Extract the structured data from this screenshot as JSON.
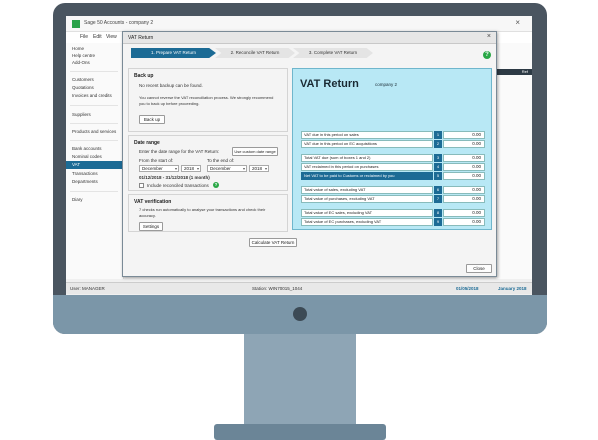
{
  "app": {
    "title": "Sage 50 Accounts - company 2",
    "close_glyph": "×",
    "menu": [
      "File",
      "Edit",
      "View"
    ]
  },
  "nav": {
    "group1": [
      "Home",
      "Help centre",
      "Add-Ons"
    ],
    "group2": [
      "Customers",
      "Quotations",
      "Invoices and credits"
    ],
    "group3": [
      "Suppliers"
    ],
    "group4": [
      "Products and services"
    ],
    "group5": [
      "Bank accounts",
      "Nominal codes",
      "VAT",
      "Transactions",
      "Departments"
    ],
    "group6": [
      "Diary"
    ],
    "active": "VAT"
  },
  "right_strip": {
    "label": "Ref"
  },
  "status": {
    "user_label": "User: MANAGER",
    "station_label": "Station: WIN70015_1044",
    "date": "01/05/2018",
    "period": "January 2018"
  },
  "dialog": {
    "title": "VAT Return",
    "close_glyph": "×",
    "steps": [
      "1. Prepare VAT Return",
      "2. Reconcile VAT Return",
      "3. Complete VAT Return"
    ],
    "help_glyph": "?"
  },
  "backup": {
    "title": "Back up",
    "line1": "No recent backup can be found.",
    "line2": "You cannot reverse the VAT reconciliation process. We strongly recommend",
    "line3": "you to back up before proceeding.",
    "button": "Back up"
  },
  "date_range": {
    "title": "Date range",
    "prompt": "Enter the date range for the VAT Return:",
    "custom_button": "Use custom date range",
    "from_label": "From the start of:",
    "to_label": "To the end of:",
    "from_month": "December",
    "from_year": "2018",
    "to_month": "December",
    "to_year": "2018",
    "summary": "01/12/2018 - 31/12/2018 (1 month)",
    "include_label": "Include reconciled transactions",
    "info_glyph": "?"
  },
  "verification": {
    "title": "VAT verification",
    "line1": "7 checks run automatically to analyse your transactions and check their",
    "line2": "accuracy.",
    "button": "Settings"
  },
  "calculate_button": "Calculate VAT Return",
  "close_button": "Close",
  "vat_return": {
    "title": "VAT Return",
    "company": "company 2",
    "rows": [
      {
        "label": "VAT due in this period on sales",
        "box": "1",
        "value": "0.00"
      },
      {
        "label": "VAT due in this period on EC acquisitions",
        "box": "2",
        "value": "0.00"
      },
      {
        "label": "Total VAT due (sum of boxes 1 and 2)",
        "box": "3",
        "value": "0.00"
      },
      {
        "label": "VAT reclaimed in this period on purchases",
        "box": "4",
        "value": "0.00"
      },
      {
        "label": "Net VAT to be paid to Customs or reclaimed by you",
        "box": "5",
        "value": "0.00"
      },
      {
        "label": "Total value of sales, excluding VAT",
        "box": "6",
        "value": "0.00"
      },
      {
        "label": "Total value of purchases, excluding VAT",
        "box": "7",
        "value": "0.00"
      },
      {
        "label": "Total value of EC sales, excluding VAT",
        "box": "8",
        "value": "0.00"
      },
      {
        "label": "Total value of EC purchases, excluding VAT",
        "box": "9",
        "value": "0.00"
      }
    ]
  }
}
